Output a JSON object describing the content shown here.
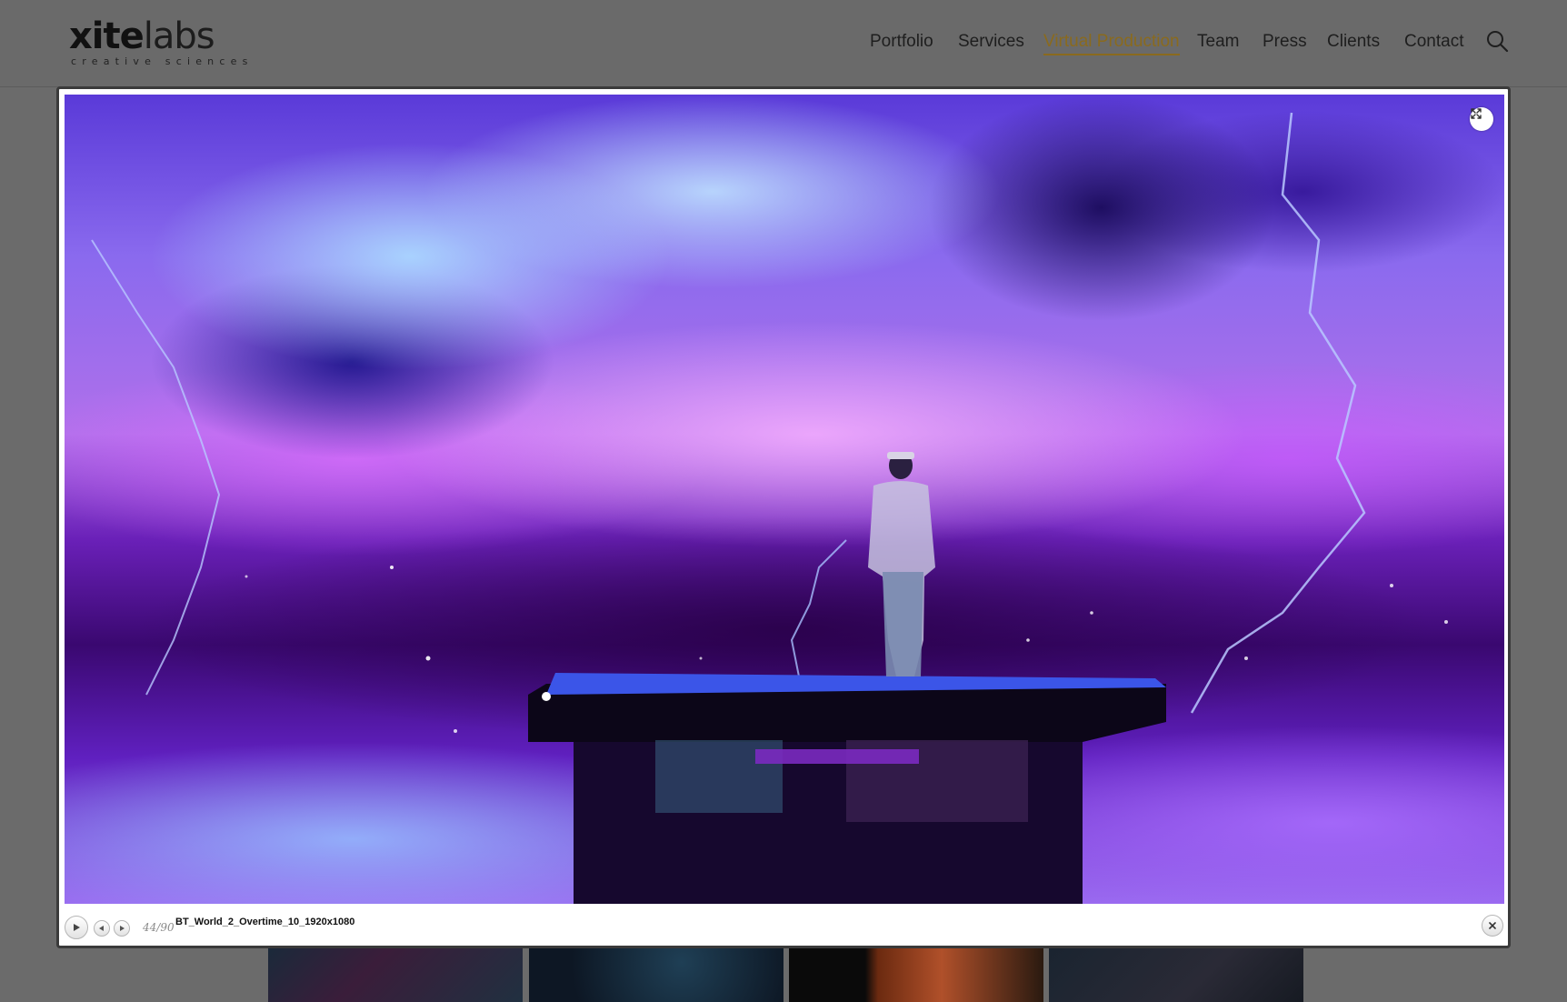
{
  "logo": {
    "main_bold": "xite",
    "main_light": "labs",
    "tagline": "creative sciences"
  },
  "nav": {
    "items": [
      {
        "label": "Portfolio",
        "active": false
      },
      {
        "label": "Services",
        "active": false
      },
      {
        "label": "Virtual Production",
        "active": true
      },
      {
        "label": "Team",
        "active": false
      },
      {
        "label": "Press",
        "active": false
      },
      {
        "label": "Clients",
        "active": false
      },
      {
        "label": "Contact",
        "active": false
      }
    ],
    "active_color": "#8a6a1e"
  },
  "lightbox": {
    "counter": "44/90",
    "caption": "BT_World_2_Overtime_10_1920x1080",
    "icons": {
      "expand": "expand-icon",
      "play": "play-icon",
      "prev": "prev-icon",
      "next": "next-icon",
      "close": "close-icon"
    }
  },
  "colors": {
    "page_bg": "#6b6b6b",
    "lightbox_bg": "#ffffff",
    "accent": "#8a6a1e"
  }
}
